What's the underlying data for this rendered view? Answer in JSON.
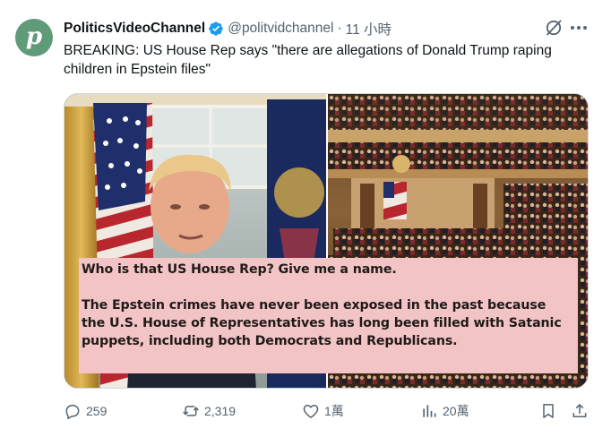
{
  "tweet": {
    "display_name": "PoliticsVideoChannel",
    "handle": "@politvidchannel",
    "separator": "·",
    "time": "11 小時",
    "avatar_letter": "p",
    "text": "BREAKING: US House Rep says \"there are allegations of Donald Trump raping children in Epstein files\""
  },
  "media_overlay": {
    "line1": "Who is that US House Rep? Give me a name.",
    "line2": "The Epstein crimes have never been exposed in the past because",
    "line3": "the U.S. House of Representatives has long been filled with Satanic",
    "line4": "puppets, including both Democrats and Republicans."
  },
  "actions": {
    "replies": "259",
    "reposts": "2,319",
    "likes": "1萬",
    "views": "20萬"
  },
  "icons": {
    "verified": "verified-badge-icon",
    "grok": "grok-icon",
    "more": "more-options-icon",
    "reply": "reply-icon",
    "repost": "repost-icon",
    "like": "heart-icon",
    "views": "views-icon",
    "bookmark": "bookmark-icon",
    "share": "share-icon"
  },
  "colors": {
    "verified_blue": "#1d9bf0",
    "avatar_green": "#5f9b78",
    "overlay_pink": "#f2c4c5",
    "secondary_text": "#536471"
  }
}
